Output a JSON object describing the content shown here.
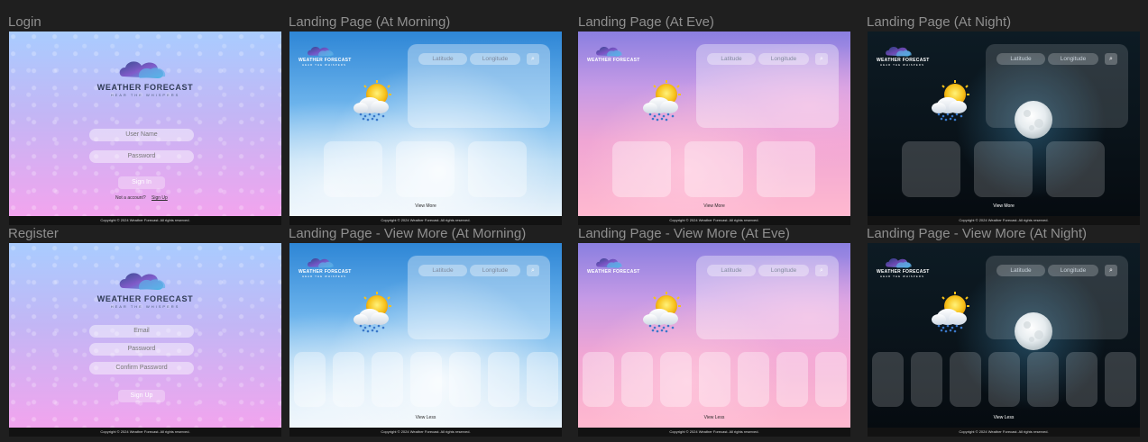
{
  "frames": {
    "login": {
      "title": "Login",
      "brand": "WEATHER FORECAST",
      "tagline": "HEAR THE WHISPERS",
      "username_placeholder": "User Name",
      "password_placeholder": "Password",
      "signin_label": "Sign In",
      "no_account_text": "Not a account?",
      "signup_link": "Sign Up",
      "footer": "Copyright © 2024 Weather Forecast. All rights reserved."
    },
    "register": {
      "title": "Register",
      "brand": "WEATHER FORECAST",
      "tagline": "HEAR THE WHISPERS",
      "email_placeholder": "Email",
      "password_placeholder": "Password",
      "confirm_placeholder": "Confirm Password",
      "signup_label": "Sign Up",
      "footer": "Copyright © 2024 Weather Forecast. All rights reserved."
    },
    "landing_morning": {
      "title": "Landing Page (At Morning)",
      "lat": "Latitude",
      "lng": "Longitude",
      "view": "View More",
      "footer": "Copyright © 2024 Weather Forecast. All rights reserved.",
      "brand": "WEATHER FORECAST",
      "tagline": "HEAR THE WHISPERS"
    },
    "landing_eve": {
      "title": "Landing Page (At Eve)",
      "lat": "Latitude",
      "lng": "Longitude",
      "view": "View More",
      "footer": "Copyright © 2024 Weather Forecast. All rights reserved.",
      "brand": "WEATHER FORECAST",
      "tagline": "HEAR THE WHISPERS"
    },
    "landing_night": {
      "title": "Landing Page (At Night)",
      "lat": "Latitude",
      "lng": "Longitude",
      "view": "View More",
      "footer": "Copyright © 2024 Weather Forecast. All rights reserved.",
      "brand": "WEATHER FORECAST",
      "tagline": "HEAR THE WHISPERS"
    },
    "vm_morning": {
      "title": "Landing Page - View More (At Morning)",
      "lat": "Latitude",
      "lng": "Longitude",
      "view": "View Less",
      "footer": "Copyright © 2024 Weather Forecast. All rights reserved.",
      "brand": "WEATHER FORECAST",
      "tagline": "HEAR THE WHISPERS"
    },
    "vm_eve": {
      "title": "Landing Page - View More (At Eve)",
      "lat": "Latitude",
      "lng": "Longitude",
      "view": "View Less",
      "footer": "Copyright © 2024 Weather Forecast. All rights reserved.",
      "brand": "WEATHER FORECAST",
      "tagline": "HEAR THE WHISPERS"
    },
    "vm_night": {
      "title": "Landing Page - View More (At Night)",
      "lat": "Latitude",
      "lng": "Longitude",
      "view": "View Less",
      "footer": "Copyright © 2024 Weather Forecast. All rights reserved.",
      "brand": "WEATHER FORECAST",
      "tagline": "HEAR THE WHISPERS"
    }
  },
  "icons": {
    "search": "search-icon",
    "weather": "sun-cloud-rain-icon",
    "moon": "moon-icon",
    "logo": "weather-cloud-logo-icon"
  },
  "colors": {
    "canvas": "#1f1f1f",
    "login_gradient_top": "#a9ccff",
    "login_gradient_bottom": "#f2a4ee",
    "morning_sky": "#2e86d6",
    "eve_sky": "#c59ae6",
    "night_sky": "#0a141b"
  }
}
